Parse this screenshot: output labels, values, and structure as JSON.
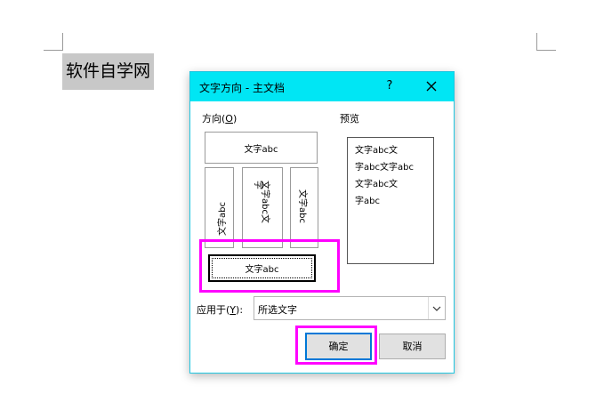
{
  "document": {
    "text": "软件自学网"
  },
  "dialog": {
    "title": "文字方向 - 主文档",
    "help_label": "?",
    "close_icon": "close-icon",
    "direction_label": "方向(",
    "direction_key": "O",
    "direction_end": ")",
    "preview_label": "预览",
    "options": {
      "horizontal": "文字abc",
      "rotate_left": "文字abc",
      "stacked_col1": "文字abc文",
      "stacked_col2": "字",
      "rotate_right": "文字abc",
      "selected": "文字abc"
    },
    "preview_lines": [
      "文字abc文",
      "字abc文字abc",
      "文字abc文",
      "字abc"
    ],
    "apply_label": "应用于(",
    "apply_key": "Y",
    "apply_end": "):",
    "apply_value": "所选文字",
    "ok_label": "确定",
    "cancel_label": "取消"
  },
  "colors": {
    "titlebar": "#00e6f4",
    "highlight": "#ff00ff",
    "ok_border": "#0078d7"
  }
}
